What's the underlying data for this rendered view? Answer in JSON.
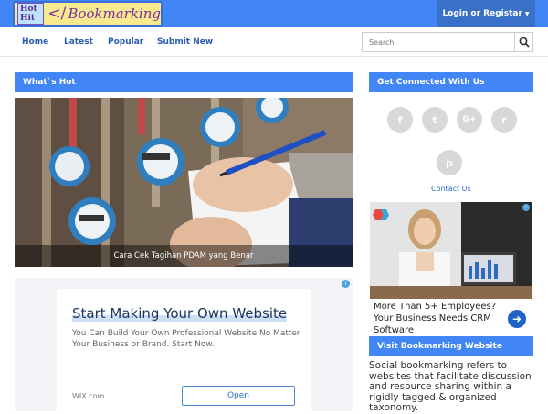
{
  "header": {
    "logo": {
      "hot": "Hot Hit",
      "tag": "</",
      "word": "Bookmarking"
    },
    "login_label": "Login or Registar",
    "login_caret": "▼"
  },
  "nav": {
    "items": [
      {
        "label": "Home"
      },
      {
        "label": "Latest"
      },
      {
        "label": "Popular"
      },
      {
        "label": "Submit New"
      }
    ],
    "search_placeholder": "Search",
    "search_icon": "magnifier"
  },
  "main": {
    "whats_hot_title": "What`s Hot",
    "featured_caption": "Cara Cek Tagihan PDAM yang Benar",
    "ad": {
      "title": "Start Making Your Own Website",
      "description": "You Can Build Your Own Professional Website No Matter Your Business or Brand. Start Now.",
      "domain": "WIX.com",
      "button": "Open"
    }
  },
  "sidebar": {
    "connect_title": "Get Connected With Us",
    "social": [
      {
        "icon": "facebook-icon",
        "glyph": "f"
      },
      {
        "icon": "twitter-icon",
        "glyph": "t"
      },
      {
        "icon": "google-plus-icon",
        "glyph": "G+"
      },
      {
        "icon": "reddit-icon",
        "glyph": "r"
      },
      {
        "icon": "pinterest-icon",
        "glyph": "p"
      }
    ],
    "contact_label": "Contact Us",
    "ad_text": "More Than 5+ Employees? Your Business Needs CRM Software",
    "visit_title": "Visit Bookmarking Website",
    "about_text": "Social bookmarking refers to websites that facilitate discussion and resource sharing within a rigidly tagged & organized taxonomy."
  },
  "colors": {
    "accent": "#4285f4",
    "login_bg": "#3b70c8",
    "link": "#2a5db0"
  }
}
